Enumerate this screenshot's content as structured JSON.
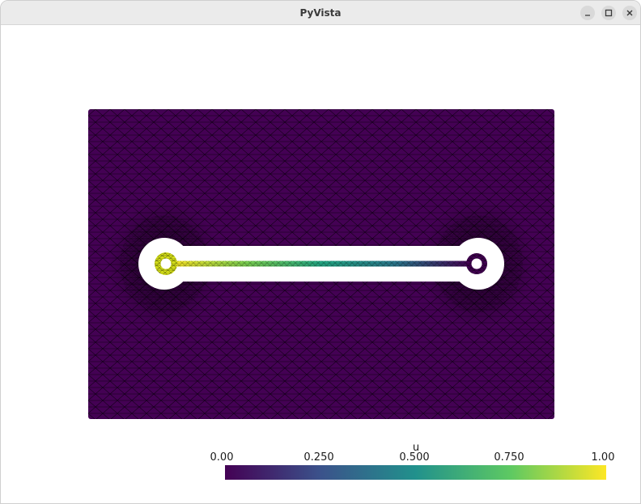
{
  "window": {
    "title": "PyVista",
    "controls": {
      "minimize_icon": "minimize-icon",
      "maximize_icon": "maximize-icon",
      "close_icon": "close-icon"
    }
  },
  "scene": {
    "background": "#ffffff",
    "mesh_color": "#440154",
    "edge_color": "#000000"
  },
  "colorbar": {
    "title": "u",
    "ticks": [
      "0.00",
      "0.250",
      "0.500",
      "0.750",
      "1.00"
    ],
    "range": [
      0.0,
      1.0
    ],
    "colormap": "viridis",
    "colors": [
      "#440154",
      "#3b528b",
      "#21918c",
      "#5ec962",
      "#fde725"
    ]
  }
}
